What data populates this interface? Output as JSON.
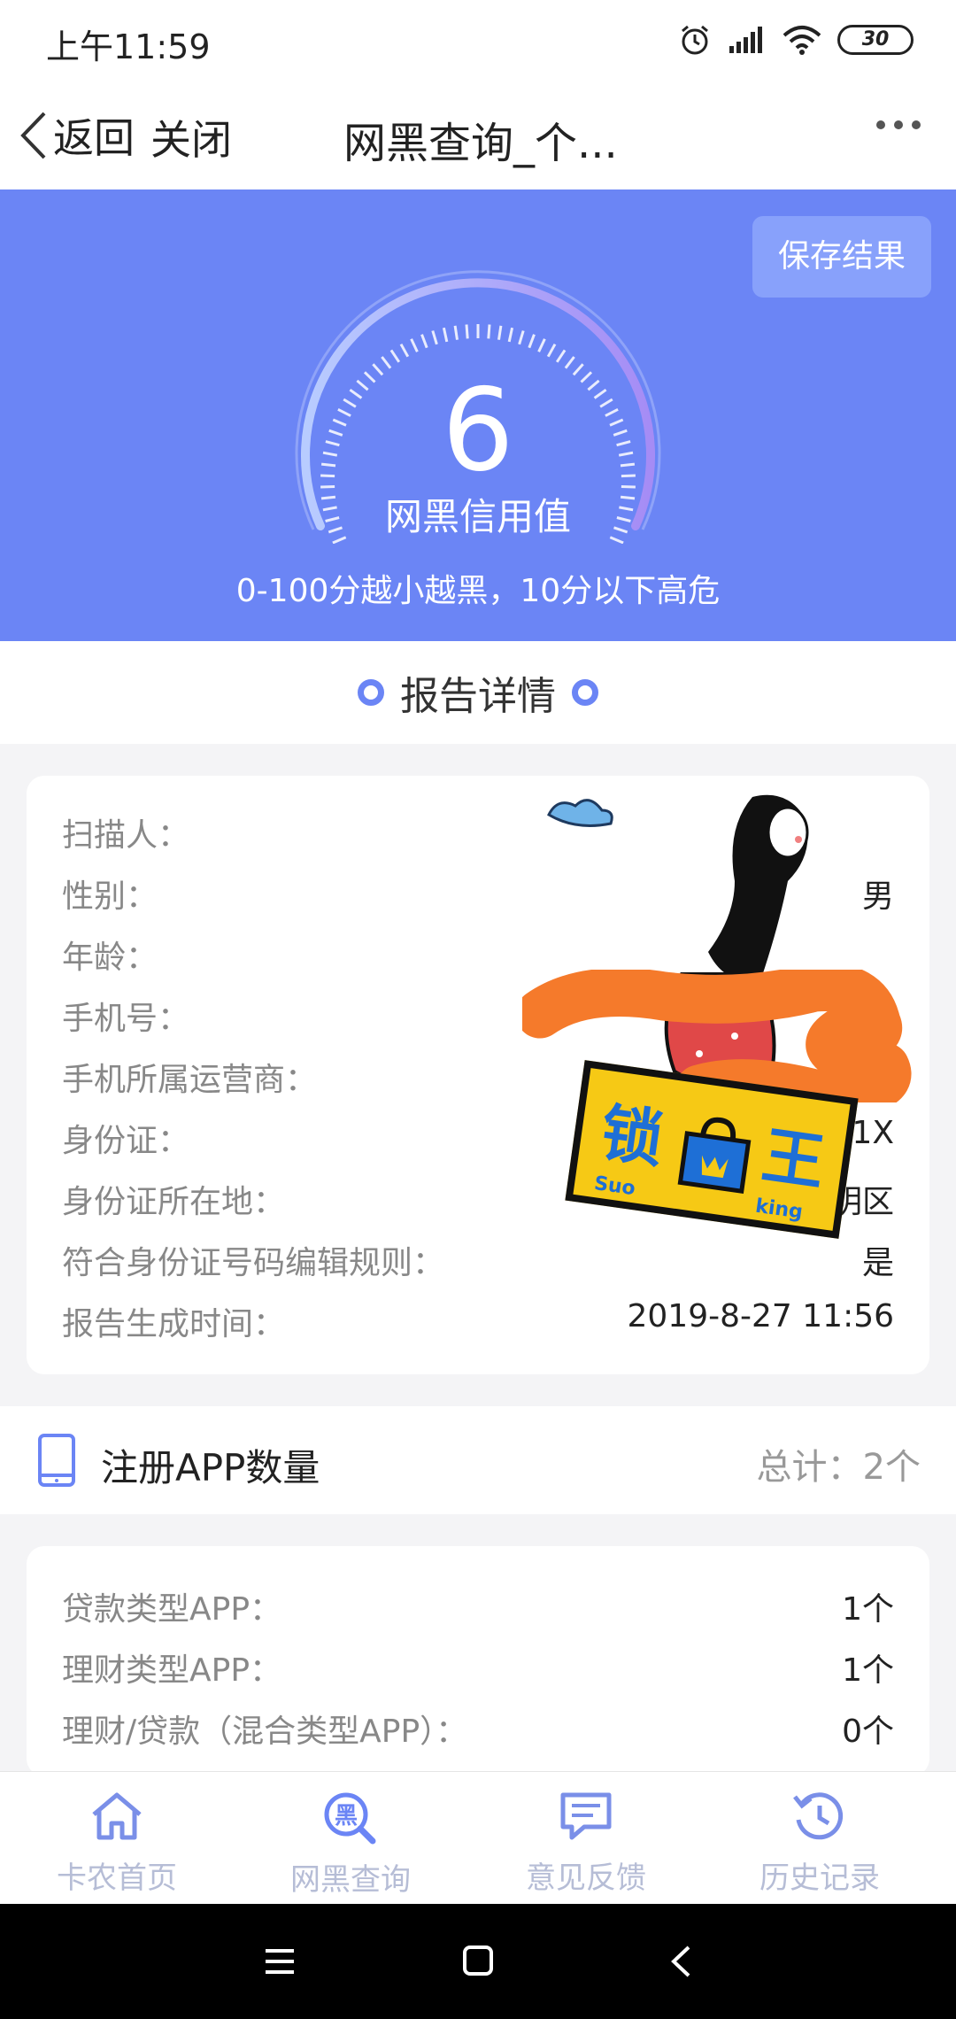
{
  "status_bar": {
    "time": "上午11:59",
    "battery": "30"
  },
  "nav": {
    "back_label": "返回",
    "close_label": "关闭",
    "title": "网黑查询_个..."
  },
  "hero": {
    "save_button": "保存结果",
    "score": "6",
    "score_label": "网黑信用值",
    "note": "0-100分越小越黑，10分以下高危",
    "accent_color": "#6b85f5"
  },
  "report": {
    "heading": "报告详情",
    "rows": [
      {
        "label": "扫描人：",
        "value": ""
      },
      {
        "label": "性别：",
        "value": "男"
      },
      {
        "label": "年龄：",
        "value": ""
      },
      {
        "label": "手机号：",
        "value": ""
      },
      {
        "label": "手机所属运营商：",
        "value": ""
      },
      {
        "label": "身份证：",
        "value": "1X"
      },
      {
        "label": "身份证所在地：",
        "value": "明区"
      },
      {
        "label": "符合身份证号码编辑规则：",
        "value": "是"
      },
      {
        "label": "报告生成时间：",
        "value": "2019-8-27 11:56"
      }
    ]
  },
  "apps": {
    "title": "注册APP数量",
    "total": "总计：2个",
    "rows": [
      {
        "label": "贷款类型APP：",
        "value": "1个"
      },
      {
        "label": "理财类型APP：",
        "value": "1个"
      },
      {
        "label": "理财/贷款（混合类型APP）：",
        "value": "0个"
      }
    ]
  },
  "sticker": {
    "text_main_left": "锁",
    "text_main_right": "王",
    "text_small_left": "Suo",
    "text_small_right": "king"
  },
  "tabs": [
    {
      "label": "卡农首页",
      "icon": "home-icon"
    },
    {
      "label": "网黑查询",
      "icon": "search-black-icon"
    },
    {
      "label": "意见反馈",
      "icon": "feedback-icon"
    },
    {
      "label": "历史记录",
      "icon": "history-icon"
    }
  ]
}
